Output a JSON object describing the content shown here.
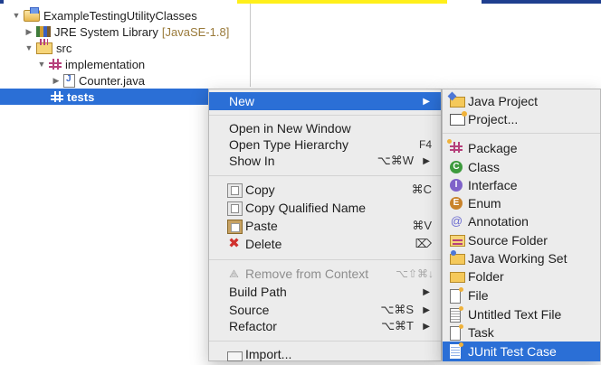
{
  "colors": {
    "selection": "#2b6fd6",
    "menu_bg": "#ececec",
    "library_tag": "#9a7a3a",
    "highlight_yellow": "#ffef1a",
    "top_blue": "#1f3f8f"
  },
  "explorer": {
    "project": "ExampleTestingUtilityClasses",
    "library": "JRE System Library",
    "library_tag": "[JavaSE-1.8]",
    "src": "src",
    "package": "implementation",
    "file": "Counter.java",
    "selected_package": "tests"
  },
  "menu": {
    "new": {
      "label": "New",
      "icon": "submenu-arrow-icon"
    },
    "open_new_window": {
      "label": "Open in New Window"
    },
    "open_type_hierarchy": {
      "label": "Open Type Hierarchy",
      "shortcut": "F4"
    },
    "show_in": {
      "label": "Show In",
      "shortcut": "⌥⌘W"
    },
    "copy": {
      "label": "Copy",
      "shortcut": "⌘C",
      "icon": "copy-icon"
    },
    "copy_qualified_name": {
      "label": "Copy Qualified Name",
      "icon": "copy-qualified-name-icon"
    },
    "paste": {
      "label": "Paste",
      "shortcut": "⌘V",
      "icon": "paste-icon"
    },
    "delete": {
      "label": "Delete",
      "shortcut": "⌦",
      "icon": "delete-icon"
    },
    "remove_from_context": {
      "label": "Remove from Context",
      "shortcut": "⌥⇧⌘↓",
      "icon": "remove-context-icon"
    },
    "build_path": {
      "label": "Build Path"
    },
    "source": {
      "label": "Source",
      "shortcut": "⌥⌘S"
    },
    "refactor": {
      "label": "Refactor",
      "shortcut": "⌥⌘T"
    },
    "import": {
      "label": "Import...",
      "icon": "import-icon"
    }
  },
  "submenu": {
    "items": [
      {
        "label": "Java Project",
        "icon": "java-project-icon"
      },
      {
        "label": "Project...",
        "icon": "project-icon"
      },
      {
        "label": "Package",
        "icon": "package-icon"
      },
      {
        "label": "Class",
        "icon": "class-icon",
        "glyph": "C"
      },
      {
        "label": "Interface",
        "icon": "interface-icon",
        "glyph": "I"
      },
      {
        "label": "Enum",
        "icon": "enum-icon",
        "glyph": "E"
      },
      {
        "label": "Annotation",
        "icon": "annotation-icon",
        "glyph": "@"
      },
      {
        "label": "Source Folder",
        "icon": "source-folder-icon"
      },
      {
        "label": "Java Working Set",
        "icon": "java-working-set-icon"
      },
      {
        "label": "Folder",
        "icon": "folder-icon"
      },
      {
        "label": "File",
        "icon": "file-icon"
      },
      {
        "label": "Untitled Text File",
        "icon": "untitled-text-file-icon"
      },
      {
        "label": "Task",
        "icon": "task-icon"
      },
      {
        "label": "JUnit Test Case",
        "icon": "junit-test-case-icon"
      }
    ]
  },
  "glyphs": {
    "expand_open": "▼",
    "expand_closed": "▶",
    "submenu_arrow": "▶",
    "delete_x": "✖",
    "remove_symbol": "⟁",
    "anno_symbol": "@"
  }
}
